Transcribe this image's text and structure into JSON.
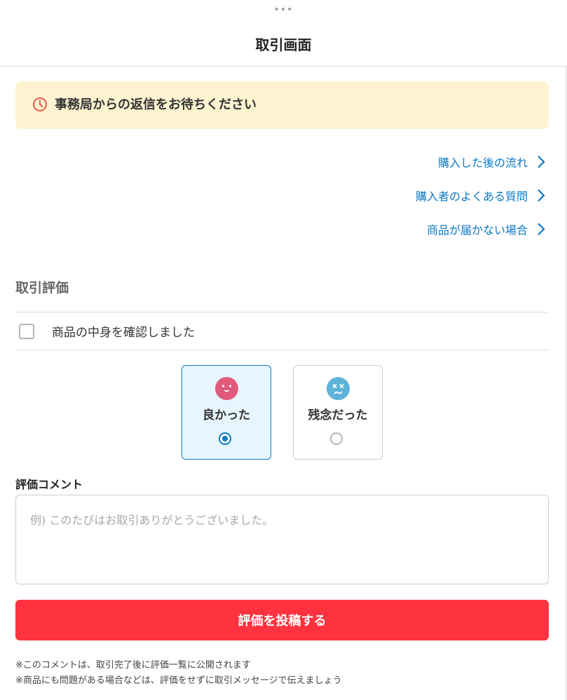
{
  "header": {
    "dots": "•••",
    "title": "取引画面"
  },
  "notice": {
    "icon": "clock-icon",
    "text": "事務局からの返信をお待ちください",
    "background": "#fdf3d0",
    "icon_color": "#e85a4f"
  },
  "links": [
    {
      "label": "購入した後の流れ"
    },
    {
      "label": "購入者のよくある質問"
    },
    {
      "label": "商品が届かない場合"
    }
  ],
  "rating": {
    "section_title": "取引評価",
    "confirm_label": "商品の中身を確認しました",
    "confirm_checked": false,
    "options": [
      {
        "label": "良かった",
        "icon": "smile-face-icon",
        "selected": true,
        "color": "#e05a7a"
      },
      {
        "label": "残念だった",
        "icon": "sad-face-icon",
        "selected": false,
        "color": "#5fb3d9"
      }
    ]
  },
  "comment": {
    "label": "評価コメント",
    "placeholder": "例) このたびはお取引ありがとうございました。",
    "value": ""
  },
  "submit_label": "評価を投稿する",
  "notes": [
    "※このコメントは、取引完了後に評価一覧に公開されます",
    "※商品にも問題がある場合などは、評価をせずに取引メッセージで伝えましょう"
  ],
  "colors": {
    "accent": "#0b79c4",
    "submit": "#ff333f"
  }
}
